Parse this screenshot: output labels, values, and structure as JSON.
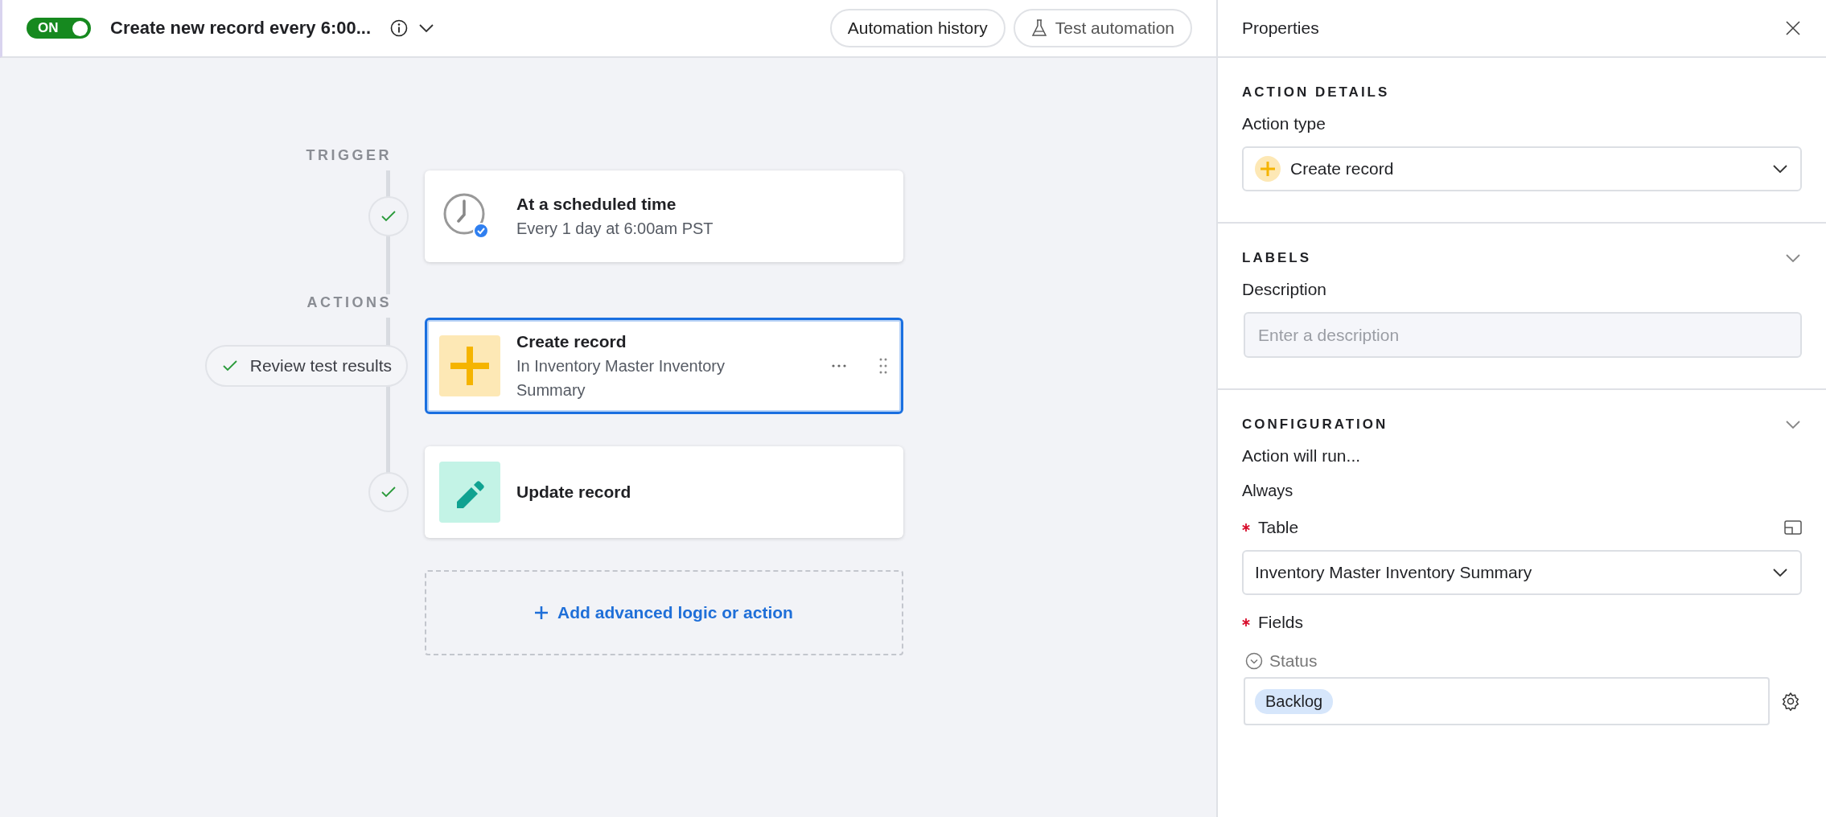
{
  "automation": {
    "enabled": true,
    "toggle_label": "ON",
    "title": "Create new record every 6:00..."
  },
  "header_buttons": [
    {
      "kind": "plain",
      "label": "Automation history"
    },
    {
      "kind": "flask",
      "label": "Test automation"
    }
  ],
  "trigger": {
    "section_label": "TRIGGER",
    "title": "At a scheduled time",
    "subtitle": "Every 1 day at 6:00am PST",
    "test_passed": true
  },
  "actions": {
    "section_label": "ACTIONS",
    "steps": [
      {
        "kind": "create",
        "title": "Create record",
        "subtitle": "In Inventory Master Inventory Summary",
        "selected": true,
        "test_passed": true,
        "review_label": "Review test results"
      },
      {
        "kind": "update",
        "title": "Update record",
        "selected": false,
        "test_passed": true
      }
    ]
  },
  "add_button": "Add advanced logic or action",
  "properties": {
    "title": "Properties",
    "action_details": {
      "heading": "ACTION DETAILS",
      "action_type_label": "Action type",
      "action_type_value": "Create record"
    },
    "labels": {
      "heading": "LABELS",
      "expanded": true,
      "description_label": "Description",
      "description_placeholder": "Enter a description"
    },
    "configuration": {
      "heading": "CONFIGURATION",
      "expanded": true,
      "run_label": "Action will run...",
      "run_value": "Always",
      "table_label": "Table",
      "table_required": true,
      "table_value": "Inventory Master Inventory Summary",
      "fields_label": "Fields",
      "fields_required": true,
      "fields": [
        {
          "name": "Status",
          "value": "Backlog"
        }
      ]
    }
  }
}
